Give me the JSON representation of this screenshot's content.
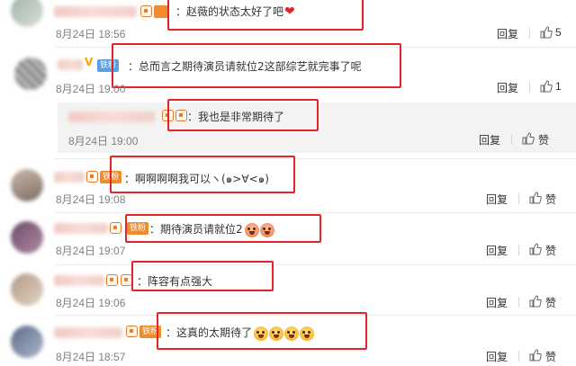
{
  "actions": {
    "reply": "回复",
    "like": "赞"
  },
  "comments": [
    {
      "text": "：赵薇的状态太好了吧",
      "date": "8月24日 18:56",
      "badge": "",
      "icons": [
        "heart-icon"
      ]
    },
    {
      "text": "：总而言之期待演员请就位2这部综艺就完事了呢",
      "date": "8月24日 19:00",
      "badge": "铁粉"
    },
    {
      "text": "：我也是非常期待了",
      "date": "8月24日 19:00"
    },
    {
      "text": "：啊啊啊啊我可以ヽ(๑>∀<๑)",
      "date": "8月24日 19:08",
      "badge": "铁粉"
    },
    {
      "text": "：期待演员请就位2",
      "date": "8月24日 19:07",
      "badge": "铁粉",
      "icons": [
        "blush-emoji-icon",
        "blush-emoji-icon"
      ]
    },
    {
      "text": "：阵容有点强大",
      "date": "8月24日 19:06"
    },
    {
      "text": "：这真的太期待了",
      "date": "8月24日 18:57",
      "badge": "铁粉",
      "icons": [
        "scream-emoji-icon",
        "scream-emoji-icon",
        "scream-emoji-icon",
        "scream-emoji-icon"
      ]
    }
  ],
  "colors": {
    "highlight": "#e3252b",
    "badge_orange": "#f08c2c",
    "badge_blue": "#5b9fe3",
    "date": "#808080",
    "reply_bg": "#f3f3f3"
  }
}
